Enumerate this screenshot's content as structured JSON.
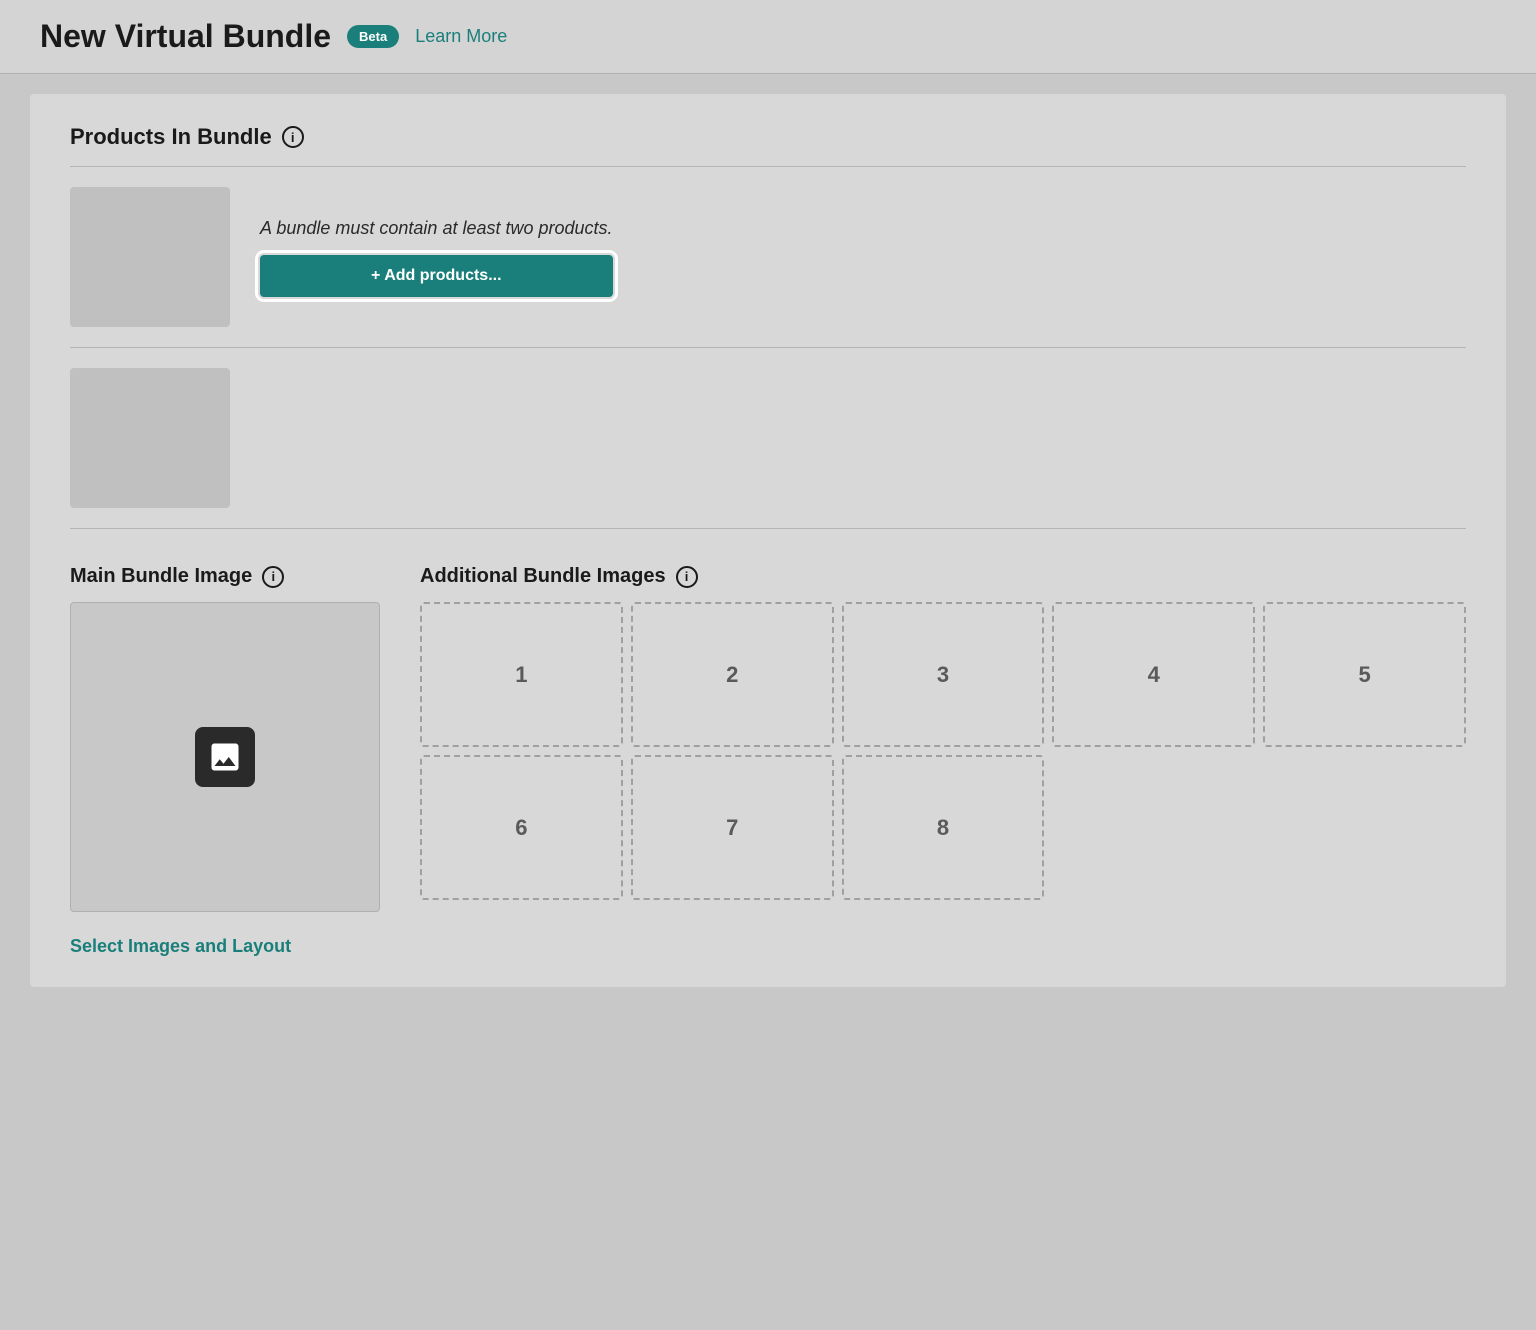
{
  "header": {
    "title": "New Virtual Bundle",
    "beta_label": "Beta",
    "learn_more_label": "Learn More"
  },
  "products_section": {
    "title": "Products In Bundle",
    "info_icon_label": "i",
    "bundle_message": "A bundle must contain at least two products.",
    "add_products_label": "+ Add products..."
  },
  "main_image_section": {
    "title": "Main Bundle Image",
    "info_icon_label": "i"
  },
  "additional_images_section": {
    "title": "Additional Bundle Images",
    "info_icon_label": "i",
    "slots": [
      {
        "number": "1"
      },
      {
        "number": "2"
      },
      {
        "number": "3"
      },
      {
        "number": "4"
      },
      {
        "number": "5"
      },
      {
        "number": "6"
      },
      {
        "number": "7"
      },
      {
        "number": "8"
      }
    ]
  },
  "select_images_label": "Select Images and Layout",
  "colors": {
    "teal": "#1a7f7a",
    "background": "#c8c8c8",
    "card_bg": "#d8d8d8"
  }
}
